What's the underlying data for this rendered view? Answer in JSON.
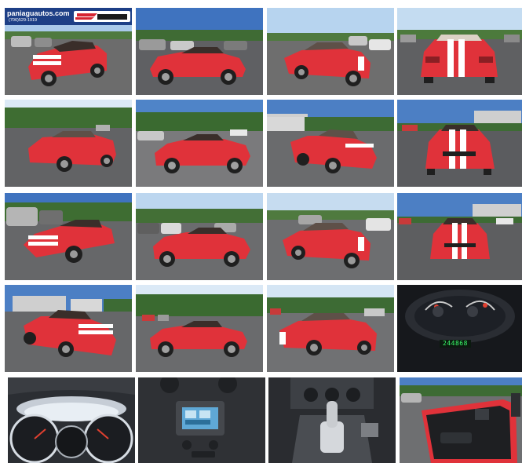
{
  "gallery": {
    "dealer_site": "paniaguautos.com",
    "dealer_phone": "(706)529-1919",
    "brand_logo": "PANIAGUA",
    "car_color": "#e0323a",
    "top_color": "#6a5a4e",
    "sky_color": "#3f73bf"
  },
  "tiles": [
    {
      "scene": "front-3q-left-lot",
      "icon": "car-photo"
    },
    {
      "scene": "side-left-lot",
      "icon": "car-photo"
    },
    {
      "scene": "rear-3q-right-lot",
      "icon": "car-photo"
    },
    {
      "scene": "rear-stripes",
      "icon": "car-photo"
    },
    {
      "scene": "rear-3q-left-trees",
      "icon": "car-photo"
    },
    {
      "scene": "side-left-trees",
      "icon": "car-photo"
    },
    {
      "scene": "front-3q-right-building",
      "icon": "car-photo"
    },
    {
      "scene": "front-stripes-building",
      "icon": "car-photo"
    },
    {
      "scene": "front-3q-left-trucks",
      "icon": "car-photo"
    },
    {
      "scene": "side-left-open-lot",
      "icon": "car-photo"
    },
    {
      "scene": "rear-3q-right-lot",
      "icon": "car-photo"
    },
    {
      "scene": "front-stripes-dealership",
      "icon": "car-photo"
    },
    {
      "scene": "front-3q-left-building",
      "icon": "car-photo"
    },
    {
      "scene": "side-left-field",
      "icon": "car-photo"
    },
    {
      "scene": "rear-3q-right-field",
      "icon": "car-photo"
    },
    {
      "scene": "gauges-closeup",
      "icon": "gauge-photo",
      "odometer": "244868"
    },
    {
      "scene": "instrument-cluster",
      "icon": "dashboard-photo"
    },
    {
      "scene": "center-console-stereo",
      "icon": "stereo-photo"
    },
    {
      "scene": "shifter-console",
      "icon": "shifter-photo"
    },
    {
      "scene": "door-panel-open",
      "icon": "door-photo"
    }
  ]
}
